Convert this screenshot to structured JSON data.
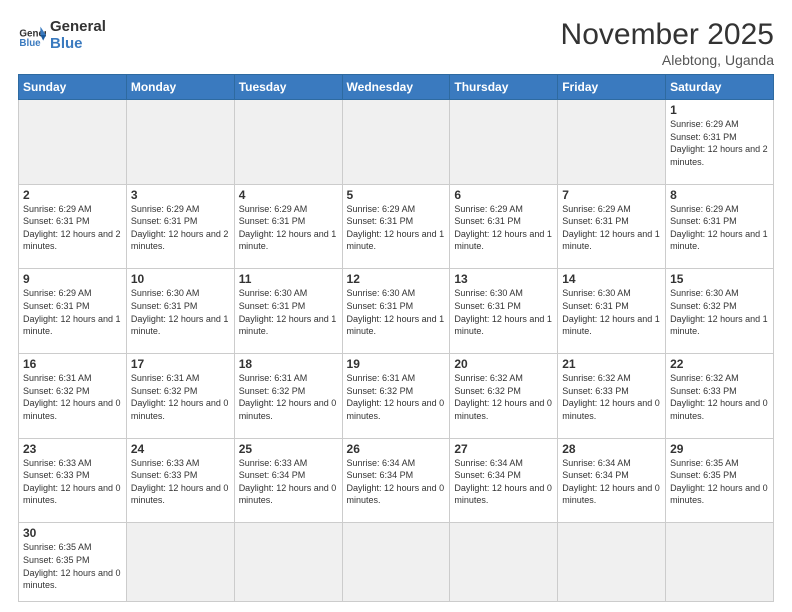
{
  "logo": {
    "text_general": "General",
    "text_blue": "Blue"
  },
  "header": {
    "month_year": "November 2025",
    "location": "Alebtong, Uganda"
  },
  "days_of_week": [
    "Sunday",
    "Monday",
    "Tuesday",
    "Wednesday",
    "Thursday",
    "Friday",
    "Saturday"
  ],
  "weeks": [
    [
      {
        "day": "",
        "info": ""
      },
      {
        "day": "",
        "info": ""
      },
      {
        "day": "",
        "info": ""
      },
      {
        "day": "",
        "info": ""
      },
      {
        "day": "",
        "info": ""
      },
      {
        "day": "",
        "info": ""
      },
      {
        "day": "1",
        "info": "Sunrise: 6:29 AM\nSunset: 6:31 PM\nDaylight: 12 hours\nand 2 minutes."
      }
    ],
    [
      {
        "day": "2",
        "info": "Sunrise: 6:29 AM\nSunset: 6:31 PM\nDaylight: 12 hours\nand 2 minutes."
      },
      {
        "day": "3",
        "info": "Sunrise: 6:29 AM\nSunset: 6:31 PM\nDaylight: 12 hours\nand 2 minutes."
      },
      {
        "day": "4",
        "info": "Sunrise: 6:29 AM\nSunset: 6:31 PM\nDaylight: 12 hours\nand 1 minute."
      },
      {
        "day": "5",
        "info": "Sunrise: 6:29 AM\nSunset: 6:31 PM\nDaylight: 12 hours\nand 1 minute."
      },
      {
        "day": "6",
        "info": "Sunrise: 6:29 AM\nSunset: 6:31 PM\nDaylight: 12 hours\nand 1 minute."
      },
      {
        "day": "7",
        "info": "Sunrise: 6:29 AM\nSunset: 6:31 PM\nDaylight: 12 hours\nand 1 minute."
      },
      {
        "day": "8",
        "info": "Sunrise: 6:29 AM\nSunset: 6:31 PM\nDaylight: 12 hours\nand 1 minute."
      }
    ],
    [
      {
        "day": "9",
        "info": "Sunrise: 6:29 AM\nSunset: 6:31 PM\nDaylight: 12 hours\nand 1 minute."
      },
      {
        "day": "10",
        "info": "Sunrise: 6:30 AM\nSunset: 6:31 PM\nDaylight: 12 hours\nand 1 minute."
      },
      {
        "day": "11",
        "info": "Sunrise: 6:30 AM\nSunset: 6:31 PM\nDaylight: 12 hours\nand 1 minute."
      },
      {
        "day": "12",
        "info": "Sunrise: 6:30 AM\nSunset: 6:31 PM\nDaylight: 12 hours\nand 1 minute."
      },
      {
        "day": "13",
        "info": "Sunrise: 6:30 AM\nSunset: 6:31 PM\nDaylight: 12 hours\nand 1 minute."
      },
      {
        "day": "14",
        "info": "Sunrise: 6:30 AM\nSunset: 6:31 PM\nDaylight: 12 hours\nand 1 minute."
      },
      {
        "day": "15",
        "info": "Sunrise: 6:30 AM\nSunset: 6:32 PM\nDaylight: 12 hours\nand 1 minute."
      }
    ],
    [
      {
        "day": "16",
        "info": "Sunrise: 6:31 AM\nSunset: 6:32 PM\nDaylight: 12 hours\nand 0 minutes."
      },
      {
        "day": "17",
        "info": "Sunrise: 6:31 AM\nSunset: 6:32 PM\nDaylight: 12 hours\nand 0 minutes."
      },
      {
        "day": "18",
        "info": "Sunrise: 6:31 AM\nSunset: 6:32 PM\nDaylight: 12 hours\nand 0 minutes."
      },
      {
        "day": "19",
        "info": "Sunrise: 6:31 AM\nSunset: 6:32 PM\nDaylight: 12 hours\nand 0 minutes."
      },
      {
        "day": "20",
        "info": "Sunrise: 6:32 AM\nSunset: 6:32 PM\nDaylight: 12 hours\nand 0 minutes."
      },
      {
        "day": "21",
        "info": "Sunrise: 6:32 AM\nSunset: 6:33 PM\nDaylight: 12 hours\nand 0 minutes."
      },
      {
        "day": "22",
        "info": "Sunrise: 6:32 AM\nSunset: 6:33 PM\nDaylight: 12 hours\nand 0 minutes."
      }
    ],
    [
      {
        "day": "23",
        "info": "Sunrise: 6:33 AM\nSunset: 6:33 PM\nDaylight: 12 hours\nand 0 minutes."
      },
      {
        "day": "24",
        "info": "Sunrise: 6:33 AM\nSunset: 6:33 PM\nDaylight: 12 hours\nand 0 minutes."
      },
      {
        "day": "25",
        "info": "Sunrise: 6:33 AM\nSunset: 6:34 PM\nDaylight: 12 hours\nand 0 minutes."
      },
      {
        "day": "26",
        "info": "Sunrise: 6:34 AM\nSunset: 6:34 PM\nDaylight: 12 hours\nand 0 minutes."
      },
      {
        "day": "27",
        "info": "Sunrise: 6:34 AM\nSunset: 6:34 PM\nDaylight: 12 hours\nand 0 minutes."
      },
      {
        "day": "28",
        "info": "Sunrise: 6:34 AM\nSunset: 6:34 PM\nDaylight: 12 hours\nand 0 minutes."
      },
      {
        "day": "29",
        "info": "Sunrise: 6:35 AM\nSunset: 6:35 PM\nDaylight: 12 hours\nand 0 minutes."
      }
    ],
    [
      {
        "day": "30",
        "info": "Sunrise: 6:35 AM\nSunset: 6:35 PM\nDaylight: 12 hours\nand 0 minutes."
      },
      {
        "day": "",
        "info": ""
      },
      {
        "day": "",
        "info": ""
      },
      {
        "day": "",
        "info": ""
      },
      {
        "day": "",
        "info": ""
      },
      {
        "day": "",
        "info": ""
      },
      {
        "day": "",
        "info": ""
      }
    ]
  ]
}
